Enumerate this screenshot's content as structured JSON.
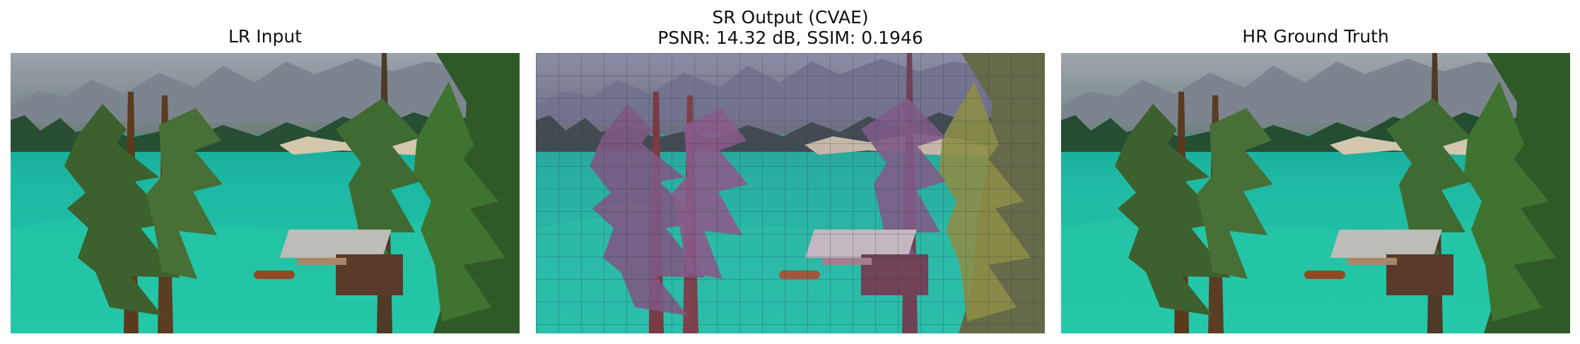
{
  "panels": [
    {
      "title_line1": "LR Input",
      "title_line2": ""
    },
    {
      "title_line1": "SR Output (CVAE)",
      "title_line2": "PSNR: 14.32 dB, SSIM: 0.1946"
    },
    {
      "title_line1": "HR Ground Truth",
      "title_line2": ""
    }
  ],
  "colors": {
    "water": "#23c7a7",
    "water_deep": "#12988f",
    "forest": "#244d32",
    "mountain": "#8c8f98",
    "tree_trunk": "#5c3a1e",
    "boathouse_roof": "#bdbdb7",
    "output_tint": "#8d4d8e"
  }
}
